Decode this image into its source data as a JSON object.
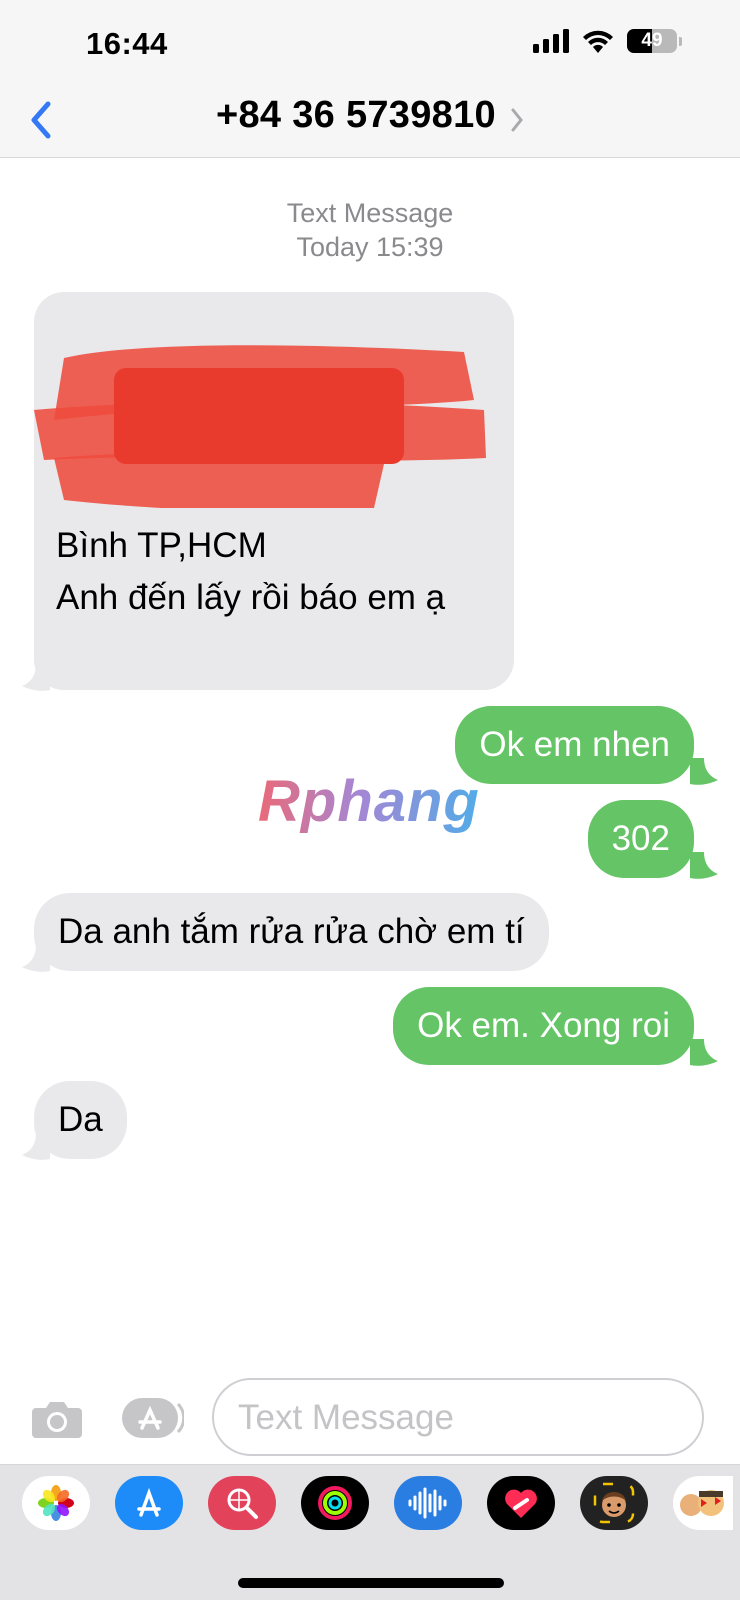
{
  "status_bar": {
    "time": "16:44",
    "battery": "49",
    "battery_level": 0.49
  },
  "header": {
    "contact": "+84 36 5739810"
  },
  "conversation": {
    "service": "Text Message",
    "date": "Today 15:39",
    "messages": [
      {
        "dir": "in",
        "lines": [
          "Bình TP,HCM",
          "Anh đến lấy rồi báo em ạ"
        ],
        "partially_redacted": true
      },
      {
        "dir": "out",
        "text": "Ok em nhen"
      },
      {
        "dir": "out",
        "text": "302"
      },
      {
        "dir": "in",
        "text": "Da anh tắm rửa rửa chờ em tí"
      },
      {
        "dir": "out",
        "text": "Ok em. Xong roi"
      },
      {
        "dir": "in",
        "text": "Da"
      }
    ]
  },
  "watermark": "Rphang",
  "input": {
    "placeholder": "Text Message"
  },
  "app_drawer": [
    "photos-app",
    "app-store",
    "search-images-app",
    "activity-app",
    "audio-message-app",
    "digital-touch-app",
    "memoji-app",
    "stickers-app"
  ],
  "colors": {
    "incoming": "#e9e9eb",
    "outgoing": "#65c466",
    "accent": "#3478f6"
  }
}
